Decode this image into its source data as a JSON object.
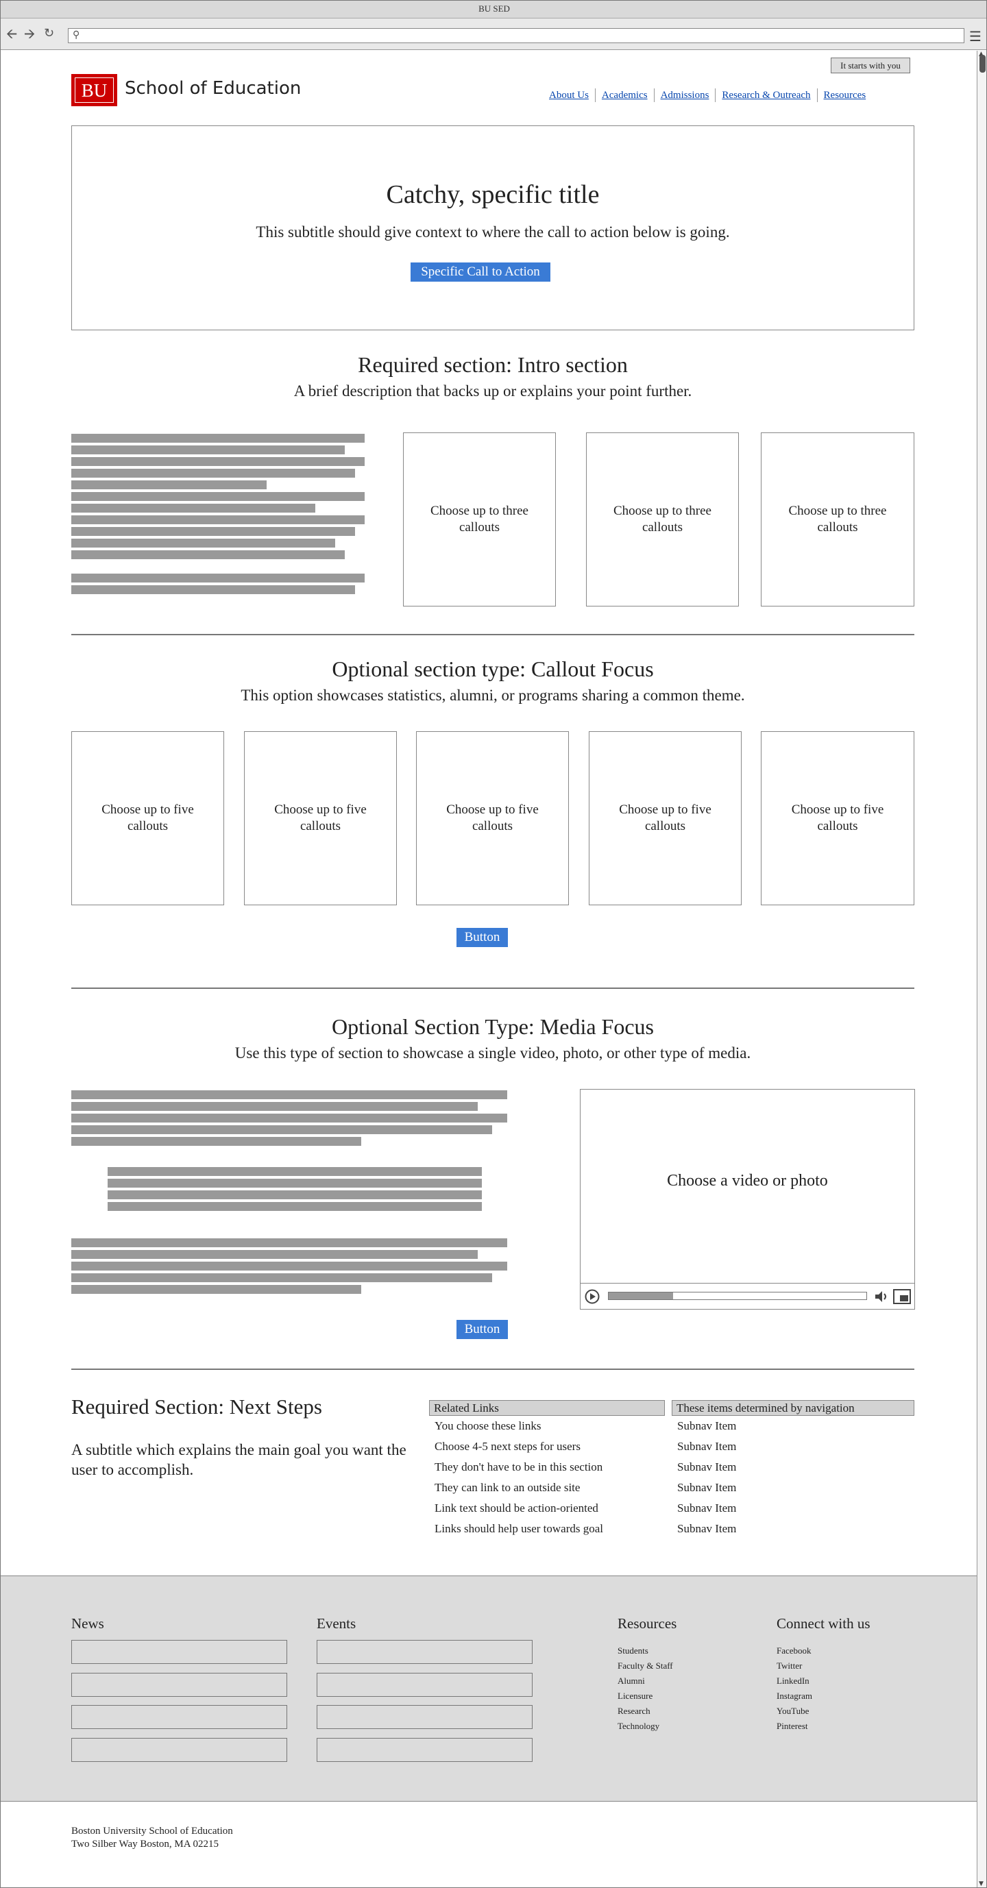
{
  "window": {
    "title": "BU SED"
  },
  "header": {
    "tag_button": "It starts with you",
    "logo_text": "BU",
    "school_name": "School of Education",
    "nav": [
      "About Us",
      "Academics",
      "Admissions",
      "Research & Outreach",
      "Resources"
    ]
  },
  "hero": {
    "title": "Catchy, specific title",
    "subtitle": "This subtitle should give context to where the call to action below is going.",
    "cta": "Specific Call to Action"
  },
  "intro": {
    "title": "Required section: Intro section",
    "subtitle": "A brief description that backs up or explains your point further.",
    "callouts": [
      "Choose up to three callouts",
      "Choose up to three callouts",
      "Choose up to three callouts"
    ]
  },
  "callout_focus": {
    "title": "Optional section type: Callout Focus",
    "subtitle": "This option showcases statistics, alumni, or programs sharing a common theme.",
    "callouts": [
      "Choose up to five callouts",
      "Choose up to five callouts",
      "Choose up to five callouts",
      "Choose up to five callouts",
      "Choose up to five callouts"
    ],
    "button": "Button"
  },
  "media_focus": {
    "title": "Optional Section Type: Media Focus",
    "subtitle": "Use this type of section to showcase a single video, photo, or other type of media.",
    "media_label": "Choose a video or photo",
    "progress": 0.25,
    "button": "Button"
  },
  "next_steps": {
    "title": "Required Section: Next Steps",
    "subtitle": "A subtitle which explains the main goal you want the user to accomplish.",
    "related_header": "Related Links",
    "related_links": [
      "You choose these links",
      "Choose 4-5 next steps for users",
      "They don't have to be in this section",
      "They can link to an outside site",
      "Link text should be action-oriented",
      "Links should help user towards goal"
    ],
    "subnav_header": "These items determined by navigation",
    "subnav_items": [
      "Subnav Item",
      "Subnav Item",
      "Subnav Item",
      "Subnav Item",
      "Subnav Item",
      "Subnav Item"
    ]
  },
  "footer": {
    "news": "News",
    "events": "Events",
    "resources_title": "Resources",
    "resources": [
      "Students",
      "Faculty & Staff",
      "Alumni",
      "Licensure",
      "Research",
      "Technology"
    ],
    "connect_title": "Connect with us",
    "connect": [
      "Facebook",
      "Twitter",
      "LinkedIn",
      "Instagram",
      "YouTube",
      "Pinterest"
    ],
    "address_line1": "Boston University School of Education",
    "address_line2": "Two Silber Way Boston, MA 02215"
  },
  "colors": {
    "brand_red": "#cc0000",
    "cta_blue": "#3a7bd5",
    "placeholder_gray": "#999999",
    "footer_bg": "#dcdcdc"
  }
}
